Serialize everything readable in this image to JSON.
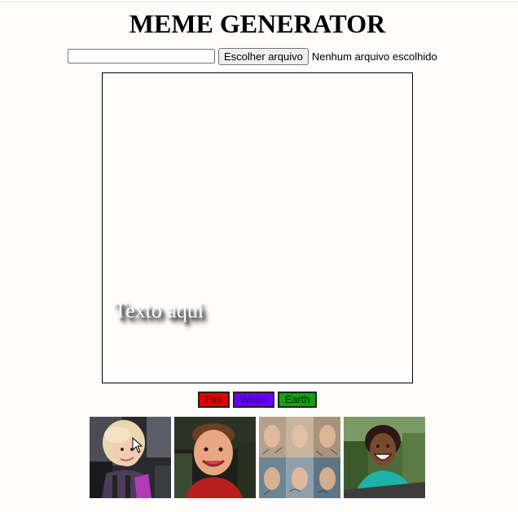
{
  "header": {
    "title": "MEME GENERATOR"
  },
  "controls": {
    "text_input_value": "",
    "file_button_label": "Escolher arquivo",
    "file_status": "Nenhum arquivo escolhido"
  },
  "canvas": {
    "overlay_text": "Texto aqui",
    "text_color": "#ffffff",
    "border_color": "#000000"
  },
  "themes": [
    {
      "label": "Fire",
      "color": "#e50000"
    },
    {
      "label": "Water",
      "color": "#6a00ff"
    },
    {
      "label": "Earth",
      "color": "#12a112"
    }
  ],
  "gallery": [
    {
      "name": "meme-thumb-girl-car",
      "icon": "photo-icon"
    },
    {
      "name": "meme-thumb-boy-smile",
      "icon": "photo-icon"
    },
    {
      "name": "meme-thumb-math-lady",
      "icon": "photo-icon"
    },
    {
      "name": "meme-thumb-woman-laughing",
      "icon": "photo-icon"
    }
  ]
}
